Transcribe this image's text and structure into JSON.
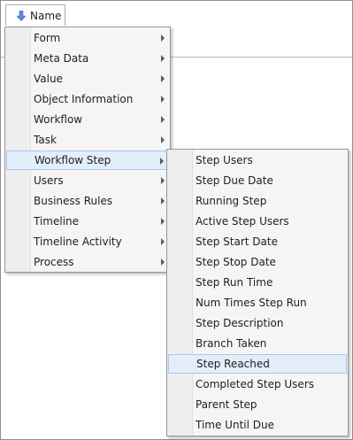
{
  "column_header": {
    "label": "Name",
    "icon": "down-arrow-icon"
  },
  "main_menu": {
    "items": [
      {
        "label": "Form",
        "has_submenu": true
      },
      {
        "label": "Meta Data",
        "has_submenu": true
      },
      {
        "label": "Value",
        "has_submenu": true
      },
      {
        "label": "Object Information",
        "has_submenu": true
      },
      {
        "label": "Workflow",
        "has_submenu": true
      },
      {
        "label": "Task",
        "has_submenu": true
      },
      {
        "label": "Workflow Step",
        "has_submenu": true,
        "highlighted": true
      },
      {
        "label": "Users",
        "has_submenu": true
      },
      {
        "label": "Business Rules",
        "has_submenu": true
      },
      {
        "label": "Timeline",
        "has_submenu": true
      },
      {
        "label": "Timeline Activity",
        "has_submenu": true
      },
      {
        "label": "Process",
        "has_submenu": true
      }
    ]
  },
  "sub_menu": {
    "items": [
      {
        "label": "Step Users"
      },
      {
        "label": "Step Due Date"
      },
      {
        "label": "Running Step"
      },
      {
        "label": "Active Step Users"
      },
      {
        "label": "Step Start Date"
      },
      {
        "label": "Step Stop Date"
      },
      {
        "label": "Step Run Time"
      },
      {
        "label": "Num Times Step Run"
      },
      {
        "label": "Step Description"
      },
      {
        "label": "Branch Taken"
      },
      {
        "label": "Step Reached",
        "highlighted": true
      },
      {
        "label": "Completed Step Users"
      },
      {
        "label": "Parent Step"
      },
      {
        "label": "Time Until Due"
      }
    ]
  },
  "colors": {
    "highlight_bg": "#e4eefb",
    "highlight_border": "#a9c6ee",
    "icon_blue": "#5b8fd6"
  }
}
